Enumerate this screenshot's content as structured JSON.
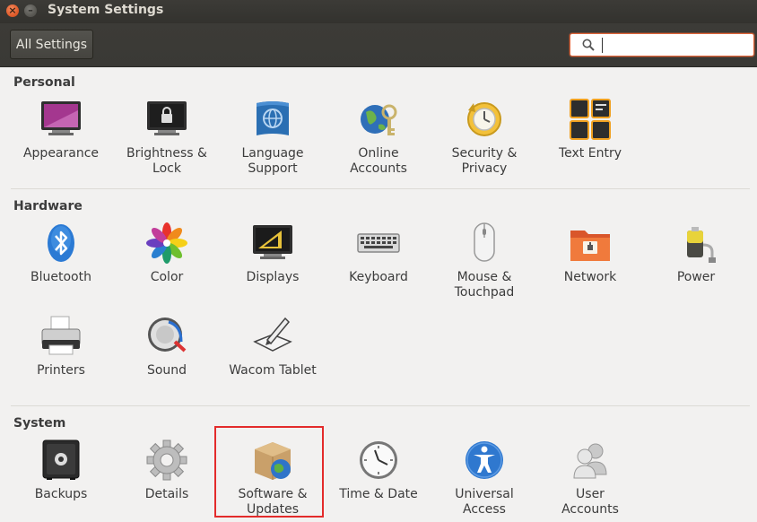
{
  "window": {
    "title": "System Settings"
  },
  "toolbar": {
    "all_settings_label": "All Settings",
    "search_value": ""
  },
  "sections": {
    "personal": {
      "title": "Personal",
      "items": [
        {
          "label": "Appearance",
          "icon": "appearance-icon"
        },
        {
          "label": "Brightness &\nLock",
          "icon": "brightness-lock-icon"
        },
        {
          "label": "Language\nSupport",
          "icon": "language-support-icon"
        },
        {
          "label": "Online\nAccounts",
          "icon": "online-accounts-icon"
        },
        {
          "label": "Security &\nPrivacy",
          "icon": "security-privacy-icon"
        },
        {
          "label": "Text Entry",
          "icon": "text-entry-icon"
        }
      ]
    },
    "hardware": {
      "title": "Hardware",
      "items": [
        {
          "label": "Bluetooth",
          "icon": "bluetooth-icon"
        },
        {
          "label": "Color",
          "icon": "color-icon"
        },
        {
          "label": "Displays",
          "icon": "displays-icon"
        },
        {
          "label": "Keyboard",
          "icon": "keyboard-icon"
        },
        {
          "label": "Mouse &\nTouchpad",
          "icon": "mouse-touchpad-icon"
        },
        {
          "label": "Network",
          "icon": "network-icon"
        },
        {
          "label": "Power",
          "icon": "power-icon"
        },
        {
          "label": "Printers",
          "icon": "printers-icon"
        },
        {
          "label": "Sound",
          "icon": "sound-icon"
        },
        {
          "label": "Wacom Tablet",
          "icon": "wacom-tablet-icon"
        }
      ]
    },
    "system": {
      "title": "System",
      "items": [
        {
          "label": "Backups",
          "icon": "backups-icon"
        },
        {
          "label": "Details",
          "icon": "details-icon"
        },
        {
          "label": "Software &\nUpdates",
          "icon": "software-updates-icon"
        },
        {
          "label": "Time & Date",
          "icon": "time-date-icon"
        },
        {
          "label": "Universal\nAccess",
          "icon": "universal-access-icon"
        },
        {
          "label": "User\nAccounts",
          "icon": "user-accounts-icon"
        }
      ]
    }
  },
  "colors": {
    "accent": "#e0653a",
    "highlight_box": "#e32b2b",
    "titlebar": "#3c3b37",
    "background": "#f2f1f0"
  }
}
